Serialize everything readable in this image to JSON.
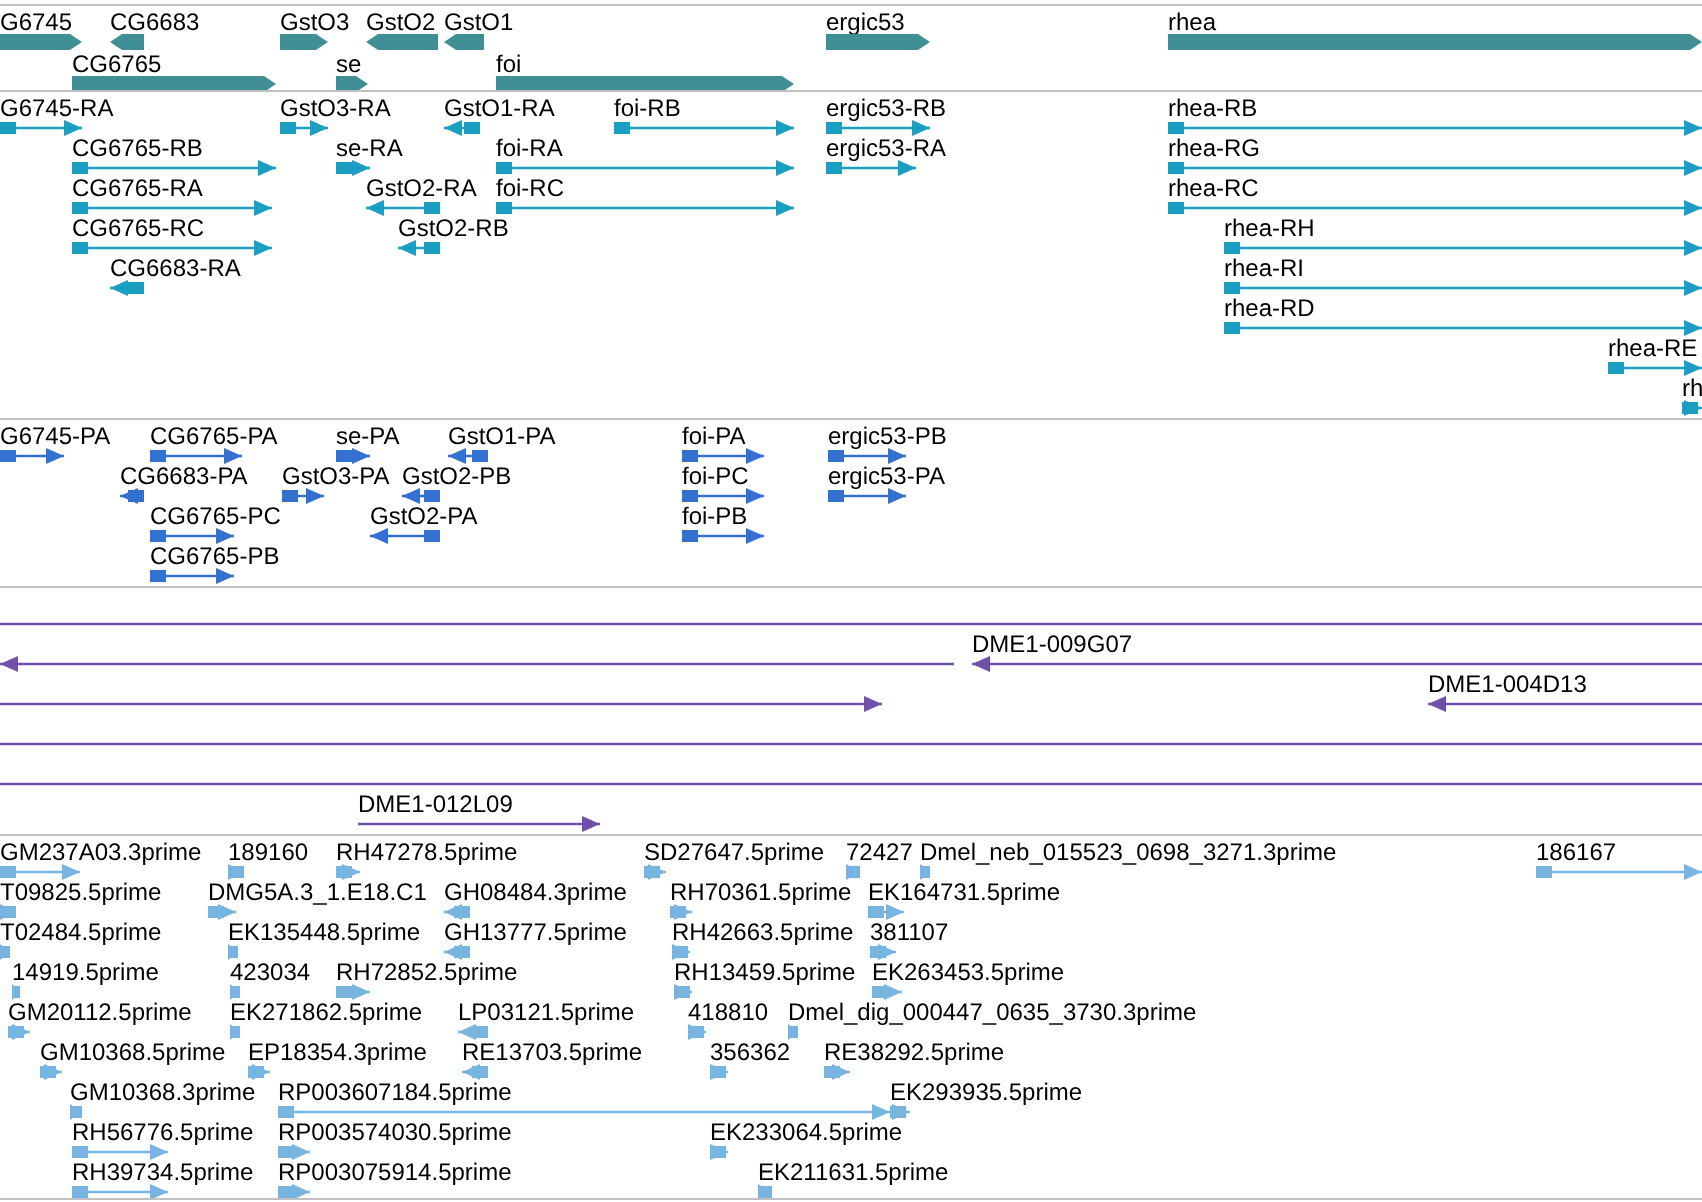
{
  "tracks": [
    {
      "kind": "gene",
      "features": [
        {
          "label": "G6745",
          "reverse": false
        },
        {
          "label": "CG6683",
          "reverse": true
        },
        {
          "label": "GstO3",
          "reverse": false
        },
        {
          "label": "GstO2",
          "reverse": true
        },
        {
          "label": "GstO1",
          "reverse": true
        },
        {
          "label": "ergic53",
          "reverse": false
        },
        {
          "label": "rhea",
          "reverse": false
        },
        {
          "label": "CG6765",
          "reverse": false
        },
        {
          "label": "se",
          "reverse": false
        },
        {
          "label": "foi",
          "reverse": false
        }
      ]
    },
    {
      "kind": "transcript",
      "features": [
        {
          "label": "G6745-RA",
          "reverse": false
        },
        {
          "label": "GstO3-RA",
          "reverse": false
        },
        {
          "label": "GstO1-RA",
          "reverse": true
        },
        {
          "label": "foi-RB",
          "reverse": false
        },
        {
          "label": "ergic53-RB",
          "reverse": false
        },
        {
          "label": "rhea-RB",
          "reverse": false
        },
        {
          "label": "CG6765-RB",
          "reverse": false
        },
        {
          "label": "se-RA",
          "reverse": false
        },
        {
          "label": "foi-RA",
          "reverse": false
        },
        {
          "label": "ergic53-RA",
          "reverse": false
        },
        {
          "label": "rhea-RG",
          "reverse": false
        },
        {
          "label": "CG6765-RA",
          "reverse": false
        },
        {
          "label": "GstO2-RA",
          "reverse": true
        },
        {
          "label": "foi-RC",
          "reverse": false
        },
        {
          "label": "rhea-RC",
          "reverse": false
        },
        {
          "label": "CG6765-RC",
          "reverse": false
        },
        {
          "label": "GstO2-RB",
          "reverse": true
        },
        {
          "label": "rhea-RH",
          "reverse": false
        },
        {
          "label": "CG6683-RA",
          "reverse": true
        },
        {
          "label": "rhea-RI",
          "reverse": false
        },
        {
          "label": "rhea-RD",
          "reverse": false
        },
        {
          "label": "rhea-RE",
          "reverse": false
        },
        {
          "label": "rh",
          "reverse": false
        }
      ]
    },
    {
      "kind": "protein",
      "features": [
        {
          "label": "G6745-PA",
          "reverse": false
        },
        {
          "label": "CG6765-PA",
          "reverse": false
        },
        {
          "label": "se-PA",
          "reverse": false
        },
        {
          "label": "GstO1-PA",
          "reverse": true
        },
        {
          "label": "foi-PA",
          "reverse": false
        },
        {
          "label": "ergic53-PB",
          "reverse": false
        },
        {
          "label": "CG6683-PA",
          "reverse": true
        },
        {
          "label": "GstO3-PA",
          "reverse": false
        },
        {
          "label": "GstO2-PB",
          "reverse": true
        },
        {
          "label": "foi-PC",
          "reverse": false
        },
        {
          "label": "ergic53-PA",
          "reverse": false
        },
        {
          "label": "CG6765-PC",
          "reverse": false
        },
        {
          "label": "GstO2-PA",
          "reverse": true
        },
        {
          "label": "foi-PB",
          "reverse": false
        },
        {
          "label": "CG6765-PB",
          "reverse": false
        }
      ]
    },
    {
      "kind": "clone",
      "features": [
        {
          "label": "DME1-009G07",
          "reverse": true
        },
        {
          "label": "DME1-004D13",
          "reverse": true
        },
        {
          "label": "DME1-012L09",
          "reverse": false
        }
      ]
    },
    {
      "kind": "est",
      "features": [
        {
          "label": "GM237A03.3prime",
          "reverse": false
        },
        {
          "label": "189160",
          "reverse": false
        },
        {
          "label": "RH47278.5prime",
          "reverse": false
        },
        {
          "label": "SD27647.5prime",
          "reverse": false
        },
        {
          "label": "72427",
          "reverse": false
        },
        {
          "label": "Dmel_neb_015523_0698_3271.3prime",
          "reverse": false
        },
        {
          "label": "186167",
          "reverse": false
        },
        {
          "label": "T09825.5prime",
          "reverse": false
        },
        {
          "label": "DMG5A.3_1.E18.C1",
          "reverse": false
        },
        {
          "label": "GH08484.3prime",
          "reverse": true
        },
        {
          "label": "RH70361.5prime",
          "reverse": false
        },
        {
          "label": "EK164731.5prime",
          "reverse": false
        },
        {
          "label": "T02484.5prime",
          "reverse": false
        },
        {
          "label": "EK135448.5prime",
          "reverse": false
        },
        {
          "label": "GH13777.5prime",
          "reverse": true
        },
        {
          "label": "RH42663.5prime",
          "reverse": false
        },
        {
          "label": "381107",
          "reverse": false
        },
        {
          "label": "14919.5prime",
          "reverse": false
        },
        {
          "label": "423034",
          "reverse": false
        },
        {
          "label": "RH72852.5prime",
          "reverse": false
        },
        {
          "label": "RH13459.5prime",
          "reverse": false
        },
        {
          "label": "EK263453.5prime",
          "reverse": false
        },
        {
          "label": "GM20112.5prime",
          "reverse": false
        },
        {
          "label": "EK271862.5prime",
          "reverse": false
        },
        {
          "label": "LP03121.5prime",
          "reverse": true
        },
        {
          "label": "418810",
          "reverse": false
        },
        {
          "label": "Dmel_dig_000447_0635_3730.3prime",
          "reverse": false
        },
        {
          "label": "GM10368.5prime",
          "reverse": false
        },
        {
          "label": "EP18354.3prime",
          "reverse": false
        },
        {
          "label": "RE13703.5prime",
          "reverse": true
        },
        {
          "label": "356362",
          "reverse": false
        },
        {
          "label": "RE38292.5prime",
          "reverse": false
        },
        {
          "label": "GM10368.3prime",
          "reverse": false
        },
        {
          "label": "RP003607184.5prime",
          "reverse": false
        },
        {
          "label": "EK293935.5prime",
          "reverse": false
        },
        {
          "label": "RH56776.5prime",
          "reverse": false
        },
        {
          "label": "RP003574030.5prime",
          "reverse": false
        },
        {
          "label": "EK233064.5prime",
          "reverse": false
        },
        {
          "label": "RH39734.5prime",
          "reverse": false
        },
        {
          "label": "RP003075914.5prime",
          "reverse": false
        },
        {
          "label": "EK211631.5prime",
          "reverse": false
        }
      ]
    }
  ]
}
